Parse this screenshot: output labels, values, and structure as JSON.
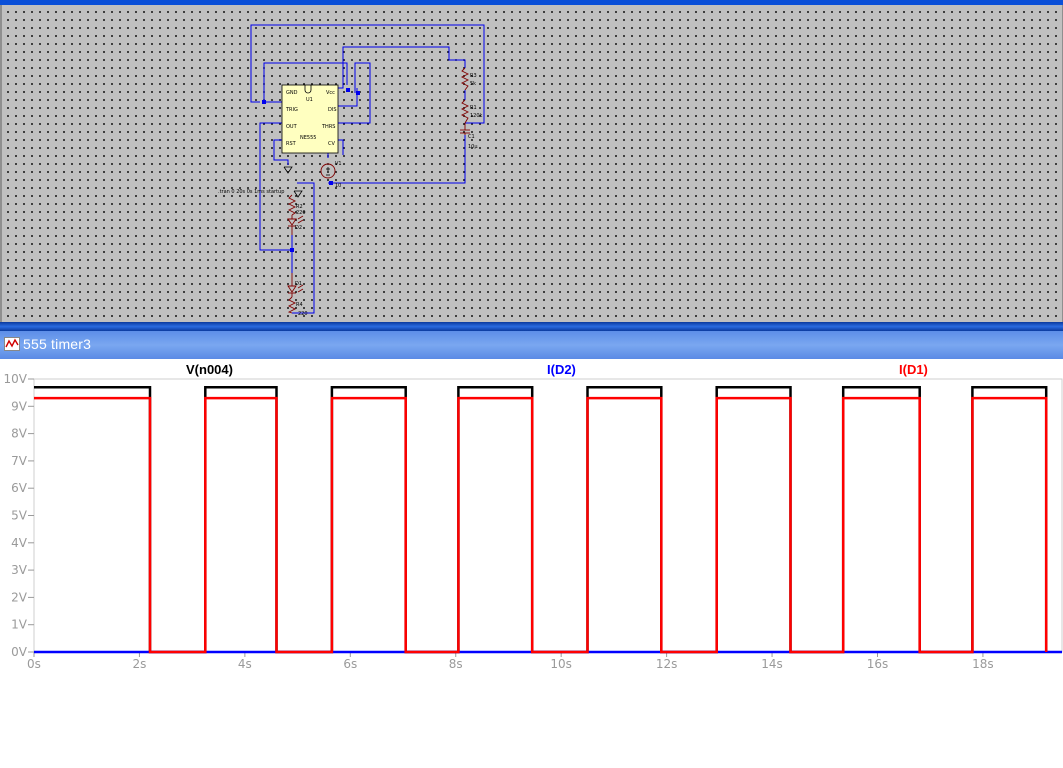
{
  "window": {
    "title": "555 timer3",
    "icon": "waveform-icon"
  },
  "schematic": {
    "directive": ".tran 0 20s 0s 1ms startup",
    "ic": {
      "ref": "U1",
      "part": "NE555",
      "pins_left": [
        "GND",
        "TRIG",
        "OUT",
        "RST"
      ],
      "pins_right": [
        "Vcc",
        "DIS",
        "THRS",
        "CV"
      ]
    },
    "components": [
      {
        "ref": "R3",
        "value": "5k"
      },
      {
        "ref": "R1",
        "value": "120k"
      },
      {
        "ref": "C1",
        "value": "10µ"
      },
      {
        "ref": "V1",
        "value": "10"
      },
      {
        "ref": "R2",
        "value": "220"
      },
      {
        "ref": "D2",
        "value": ""
      },
      {
        "ref": "D1",
        "value": ""
      },
      {
        "ref": "R4",
        "value": "220"
      }
    ],
    "colors": {
      "wire": "#0000ee",
      "component": "#800000",
      "canvas": "#c0c0c0",
      "ic_fill": "#ffffc0"
    }
  },
  "chart_data": {
    "type": "line",
    "legend": [
      "V(n004)",
      "I(D2)",
      "I(D1)"
    ],
    "series": [
      {
        "name": "V(n004)",
        "color": "#000000",
        "points": [
          [
            0,
            9.7
          ],
          [
            2.2,
            9.7
          ],
          [
            2.2,
            0
          ],
          [
            3.25,
            0
          ],
          [
            3.25,
            9.7
          ],
          [
            4.6,
            9.7
          ],
          [
            4.6,
            0
          ],
          [
            5.65,
            0
          ],
          [
            5.65,
            9.7
          ],
          [
            7.05,
            9.7
          ],
          [
            7.05,
            0
          ],
          [
            8.05,
            0
          ],
          [
            8.05,
            9.7
          ],
          [
            9.45,
            9.7
          ],
          [
            9.45,
            0
          ],
          [
            10.5,
            0
          ],
          [
            10.5,
            9.7
          ],
          [
            11.9,
            9.7
          ],
          [
            11.9,
            0
          ],
          [
            12.95,
            0
          ],
          [
            12.95,
            9.7
          ],
          [
            14.35,
            9.7
          ],
          [
            14.35,
            0
          ],
          [
            15.35,
            0
          ],
          [
            15.35,
            9.7
          ],
          [
            16.8,
            9.7
          ],
          [
            16.8,
            0
          ],
          [
            17.8,
            0
          ],
          [
            17.8,
            9.7
          ],
          [
            19.2,
            9.7
          ],
          [
            19.2,
            0
          ]
        ]
      },
      {
        "name": "I(D2)",
        "color": "#0000ff",
        "points": [
          [
            0,
            0
          ],
          [
            19.5,
            0
          ]
        ]
      },
      {
        "name": "I(D1)",
        "color": "#ff0000",
        "points": [
          [
            0,
            9.3
          ],
          [
            2.2,
            9.3
          ],
          [
            2.2,
            0
          ],
          [
            3.25,
            0
          ],
          [
            3.25,
            9.3
          ],
          [
            4.6,
            9.3
          ],
          [
            4.6,
            0
          ],
          [
            5.65,
            0
          ],
          [
            5.65,
            9.3
          ],
          [
            7.05,
            9.3
          ],
          [
            7.05,
            0
          ],
          [
            8.05,
            0
          ],
          [
            8.05,
            9.3
          ],
          [
            9.45,
            9.3
          ],
          [
            9.45,
            0
          ],
          [
            10.5,
            0
          ],
          [
            10.5,
            9.3
          ],
          [
            11.9,
            9.3
          ],
          [
            11.9,
            0
          ],
          [
            12.95,
            0
          ],
          [
            12.95,
            9.3
          ],
          [
            14.35,
            9.3
          ],
          [
            14.35,
            0
          ],
          [
            15.35,
            0
          ],
          [
            15.35,
            9.3
          ],
          [
            16.8,
            9.3
          ],
          [
            16.8,
            0
          ],
          [
            17.8,
            0
          ],
          [
            17.8,
            9.3
          ],
          [
            19.2,
            9.3
          ],
          [
            19.2,
            0
          ]
        ]
      }
    ],
    "xlim": [
      0,
      19.5
    ],
    "ylim": [
      0,
      10
    ],
    "x_ticks": [
      "0s",
      "2s",
      "4s",
      "6s",
      "8s",
      "10s",
      "12s",
      "14s",
      "16s",
      "18s"
    ],
    "x_tick_values": [
      0,
      2,
      4,
      6,
      8,
      10,
      12,
      14,
      16,
      18
    ],
    "y_ticks": [
      "0V",
      "1V",
      "2V",
      "3V",
      "4V",
      "5V",
      "6V",
      "7V",
      "8V",
      "9V",
      "10V"
    ],
    "y_tick_values": [
      0,
      1,
      2,
      3,
      4,
      5,
      6,
      7,
      8,
      9,
      10
    ],
    "grid": false
  }
}
